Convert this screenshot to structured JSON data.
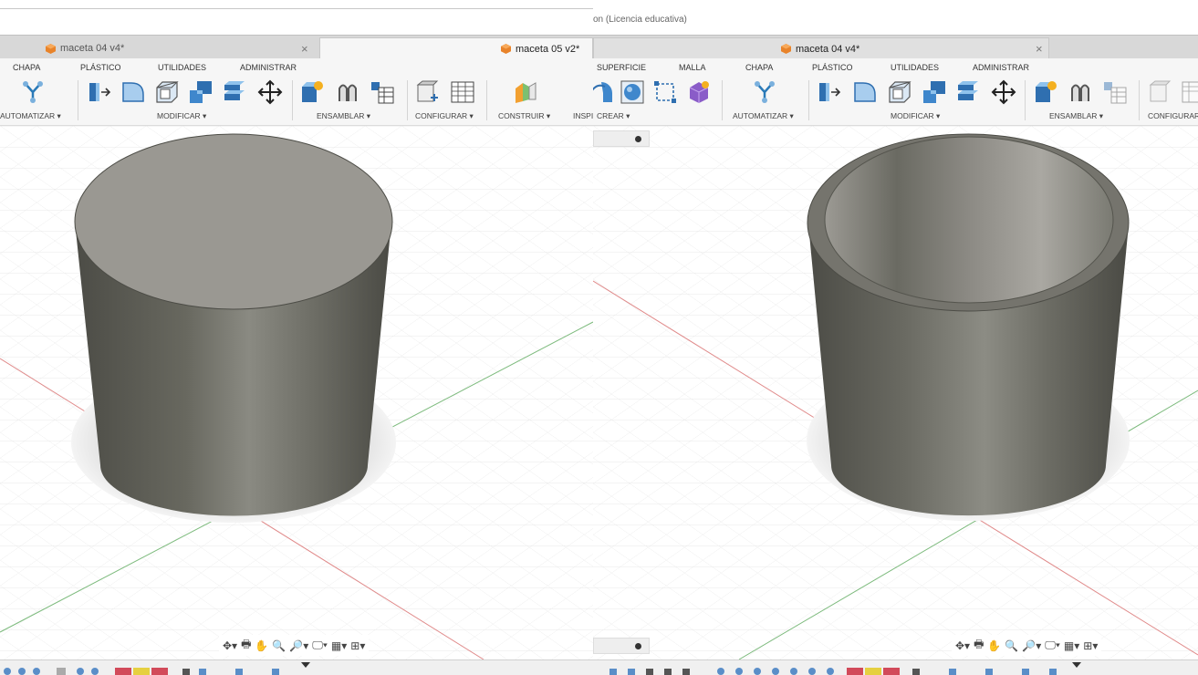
{
  "title_suffix": "on (Licencia educativa)",
  "left": {
    "tabs": [
      {
        "label": "maceta 04 v4*",
        "close": "×"
      },
      {
        "label": "maceta 05 v2*",
        "close": "×"
      }
    ],
    "ribbon_tabs": [
      "CHAPA",
      "PLÁSTICO",
      "UTILIDADES",
      "ADMINISTRAR"
    ],
    "groups": [
      "AUTOMATIZAR ▾",
      "MODIFICAR ▾",
      "ENSAMBLAR ▾",
      "CONFIGURAR ▾",
      "CONSTRUIR ▾",
      "INSPI"
    ],
    "tools": [
      "automate-icon",
      "press-pull-icon",
      "fillet-icon",
      "shell-icon",
      "combine-icon",
      "split-icon",
      "move-icon",
      "new-component-icon",
      "joint-icon",
      "assembly-table-icon",
      "configure-icon",
      "configure-table-icon",
      "construct-plane-icon"
    ]
  },
  "right": {
    "tabs": [
      {
        "label": "maceta 04 v4*",
        "close": "×"
      }
    ],
    "ribbon_tabs": [
      "SUPERFICIE",
      "MALLA",
      "CHAPA",
      "PLÁSTICO",
      "UTILIDADES",
      "ADMINISTRAR"
    ],
    "groups": [
      "CREAR ▾",
      "AUTOMATIZAR ▾",
      "MODIFICAR ▾",
      "ENSAMBLAR ▾",
      "CONFIGURAR"
    ],
    "tools": [
      "revolve-icon",
      "sphere-icon",
      "sketch-icon",
      "form-icon",
      "automate-icon",
      "press-pull-icon",
      "fillet-icon",
      "shell-icon",
      "combine-icon",
      "split-icon",
      "move-icon",
      "new-component-icon",
      "joint-icon",
      "assembly-table-icon",
      "configure-icon",
      "configure-table-icon"
    ]
  },
  "navbar_icons": [
    "orbit-icon",
    "look-at-icon",
    "pan-icon",
    "zoom-icon",
    "fit-icon",
    "display-settings-icon",
    "grid-icon",
    "viewports-icon"
  ],
  "colors": {
    "ribbon_bg": "#f6f6f6",
    "body_dark": "#55554e",
    "body_light": "#8a8a84",
    "top_face": "#9a9892",
    "axis_red": "#e08080",
    "axis_green": "#70b070"
  }
}
